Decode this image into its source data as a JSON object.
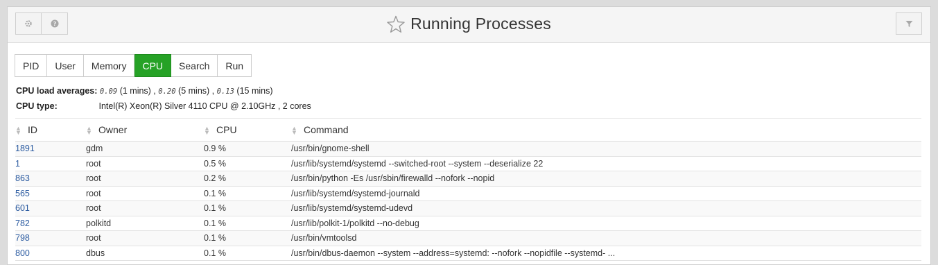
{
  "header": {
    "title": "Running Processes",
    "buttons": [
      "gear-icon",
      "help-icon",
      "filter-icon"
    ]
  },
  "tabs": [
    {
      "label": "PID",
      "active": false
    },
    {
      "label": "User",
      "active": false
    },
    {
      "label": "Memory",
      "active": false
    },
    {
      "label": "CPU",
      "active": true
    },
    {
      "label": "Search",
      "active": false
    },
    {
      "label": "Run",
      "active": false
    }
  ],
  "cpu": {
    "load_label": "CPU load averages:",
    "load1": "0.09",
    "load1_suffix": "(1 mins) ,",
    "load5": "0.20",
    "load5_suffix": "(5 mins) ,",
    "load15": "0.13",
    "load15_suffix": "(15 mins)",
    "type_label": "CPU type:",
    "type_value": "Intel(R) Xeon(R) Silver 4110 CPU @ 2.10GHz , 2 cores"
  },
  "table": {
    "columns": [
      "ID",
      "Owner",
      "CPU",
      "Command"
    ],
    "rows": [
      {
        "id": "1891",
        "owner": "gdm",
        "cpu": "0.9 %",
        "command": "/usr/bin/gnome-shell"
      },
      {
        "id": "1",
        "owner": "root",
        "cpu": "0.5 %",
        "command": "/usr/lib/systemd/systemd --switched-root --system --deserialize 22"
      },
      {
        "id": "863",
        "owner": "root",
        "cpu": "0.2 %",
        "command": "/usr/bin/python -Es /usr/sbin/firewalld --nofork --nopid"
      },
      {
        "id": "565",
        "owner": "root",
        "cpu": "0.1 %",
        "command": "/usr/lib/systemd/systemd-journald"
      },
      {
        "id": "601",
        "owner": "root",
        "cpu": "0.1 %",
        "command": "/usr/lib/systemd/systemd-udevd"
      },
      {
        "id": "782",
        "owner": "polkitd",
        "cpu": "0.1 %",
        "command": "/usr/lib/polkit-1/polkitd --no-debug"
      },
      {
        "id": "798",
        "owner": "root",
        "cpu": "0.1 %",
        "command": "/usr/bin/vmtoolsd"
      },
      {
        "id": "800",
        "owner": "dbus",
        "cpu": "0.1 %",
        "command": "/usr/bin/dbus-daemon --system --address=systemd: --nofork --nopidfile --systemd- ..."
      }
    ]
  }
}
